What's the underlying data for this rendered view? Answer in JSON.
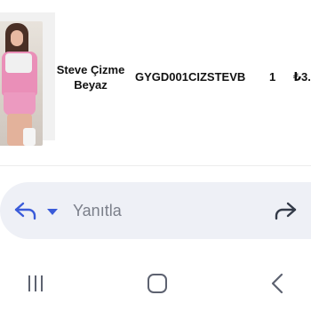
{
  "order_item": {
    "image_icon": "product-photo-pink-outfit",
    "name_line1": "Steve Çizme",
    "name_line2": "Beyaz",
    "sku": "GYGD001CIZSTEVB",
    "quantity": "1",
    "price": "₺3."
  },
  "reply_bar": {
    "reply_icon": "reply-arrow-icon",
    "dropdown_icon": "chevron-down-icon",
    "placeholder": "Yanıtla",
    "forward_icon": "forward-arrow-icon"
  },
  "nav_bar": {
    "recents_icon": "recents-icon",
    "home_icon": "home-icon",
    "back_icon": "back-icon"
  },
  "colors": {
    "accent": "#3a5bd9",
    "reply_bar_bg": "#eef0f6",
    "placeholder_text": "#7b7f8a"
  }
}
